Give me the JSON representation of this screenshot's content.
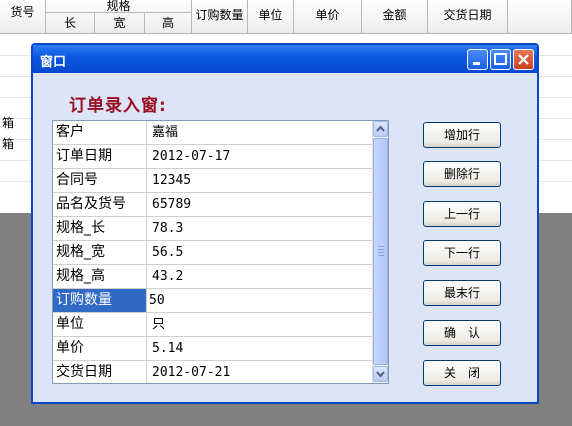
{
  "background": {
    "headers": {
      "huohao": "货号",
      "guige": "规格",
      "chang": "长",
      "kuan": "宽",
      "gao": "高",
      "qty": "订购数量",
      "unit": "单位",
      "price": "单价",
      "amount": "金额",
      "delivery": "交货日期"
    },
    "side_labels": [
      "箱",
      "箱"
    ]
  },
  "window": {
    "title": "窗口",
    "heading": "订单录入窗:",
    "rows": [
      {
        "label": "客户",
        "value": "嘉福"
      },
      {
        "label": "订单日期",
        "value": "2012-07-17"
      },
      {
        "label": "合同号",
        "value": "12345"
      },
      {
        "label": "品名及货号",
        "value": "65789"
      },
      {
        "label": "规格_长",
        "value": "78.3"
      },
      {
        "label": "规格_宽",
        "value": "56.5"
      },
      {
        "label": "规格_高",
        "value": "43.2"
      },
      {
        "label": "订购数量",
        "value": "50"
      },
      {
        "label": "单位",
        "value": "只"
      },
      {
        "label": "单价",
        "value": "5.14"
      },
      {
        "label": "交货日期",
        "value": "2012-07-21"
      }
    ],
    "buttons": {
      "add": "增加行",
      "delete": "删除行",
      "prev": "上一行",
      "next": "下一行",
      "last": "最末行",
      "confirm": "确　认",
      "close": "关　闭"
    }
  }
}
